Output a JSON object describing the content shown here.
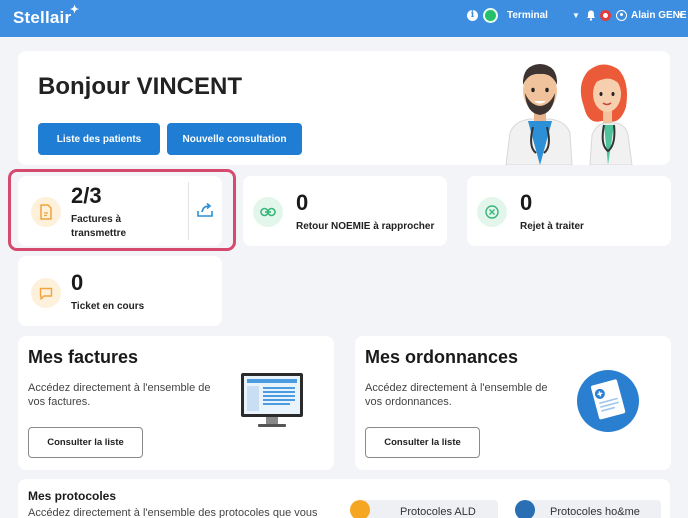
{
  "topbar": {
    "logo": "Stellair",
    "info_icon": "i",
    "terminal_label": "Terminal",
    "user_name": "Alain GENE",
    "brand_color": "#3d8ee0"
  },
  "hero": {
    "greeting": "Bonjour VINCENT",
    "btn_patients": "Liste des patients",
    "btn_consultation": "Nouvelle consultation"
  },
  "stats": {
    "factures": {
      "count": "2/3",
      "label": "Factures à transmettre",
      "icon": "document-icon",
      "action_icon": "upload-icon"
    },
    "noemie": {
      "count": "0",
      "label": "Retour NOEMIE à rapprocher",
      "icon": "link-icon"
    },
    "rejet": {
      "count": "0",
      "label": "Rejet à traiter",
      "icon": "close-circle-icon"
    },
    "ticket": {
      "count": "0",
      "label": "Ticket en cours",
      "icon": "chat-icon"
    }
  },
  "factures_card": {
    "title": "Mes factures",
    "desc": "Accédez directement à l'ensemble de vos factures.",
    "button": "Consulter la liste"
  },
  "ordonnances_card": {
    "title": "Mes ordonnances",
    "desc": "Accédez directement à l'ensemble de vos ordonnances.",
    "button": "Consulter la liste"
  },
  "protocoles": {
    "title": "Mes protocoles",
    "desc": "Accédez directement à l'ensemble des protocoles que vous",
    "pill_ald": "Protocoles ALD",
    "pill_home": "Protocoles ho&me"
  }
}
